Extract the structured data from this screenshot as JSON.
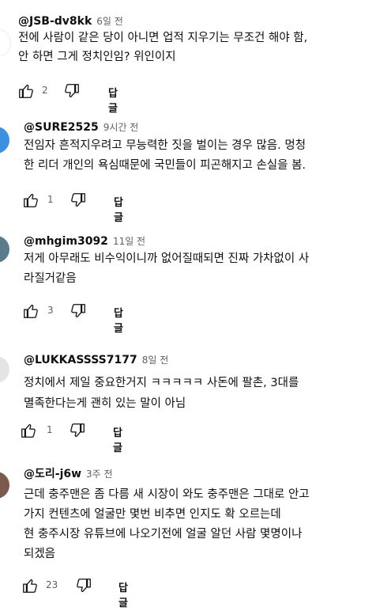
{
  "comments": [
    {
      "author": "@JSB-dv8kk",
      "time": "6일 전",
      "lines": [
        "전에 사람이 같은 당이 아니면 업적 지우기는 무조건 해야 함,",
        "안 하면 그게 정치인임? 위인이지"
      ],
      "likes": "2",
      "reply": "답글",
      "avatar_color": "#ffffff"
    },
    {
      "author": "@SURE2525",
      "time": "9시간 전",
      "lines": [
        "전임자 흔적지우려고 무능력한 짓을 벌이는 경우 많음. 멍청",
        "한 리더 개인의 욕심때문에 국민들이 피곤해지고 손실을 봄."
      ],
      "likes": "1",
      "reply": "답글",
      "avatar_color": "#3d8fe0"
    },
    {
      "author": "@mhgim3092",
      "time": "11일 전",
      "lines": [
        "저게 아무래도 비수익이니까 없어질때되면 진짜 가차없이 사",
        "라질거같음"
      ],
      "likes": "3",
      "reply": "답글",
      "avatar_color": "#5b7b8a"
    },
    {
      "author": "@LUKKASSSS7177",
      "time": "8일 전",
      "lines": [
        "정치에서 제일 중요한거지 ㅋㅋㅋㅋㅋ 사돈에 팔촌, 3대를",
        "멸족한다는게 괜히 있는 말이 아님"
      ],
      "likes": "1",
      "reply": "답글",
      "avatar_color": "#e4e4e4"
    },
    {
      "author": "@도리-j6w",
      "time": "3주 전",
      "lines": [
        "근데 충주맨은 좀 다름 새 시장이 와도 충주맨은 그대로 안고",
        "가지 컨텐츠에 얼굴만 몇번 비추면 인지도 확 오르는데",
        "현 충주시장 유튜브에 나오기전에 얼굴 알던 사람 몇명이나",
        "되겠음"
      ],
      "likes": "23",
      "reply": "답글",
      "avatar_color": "#7a5a4c"
    }
  ]
}
